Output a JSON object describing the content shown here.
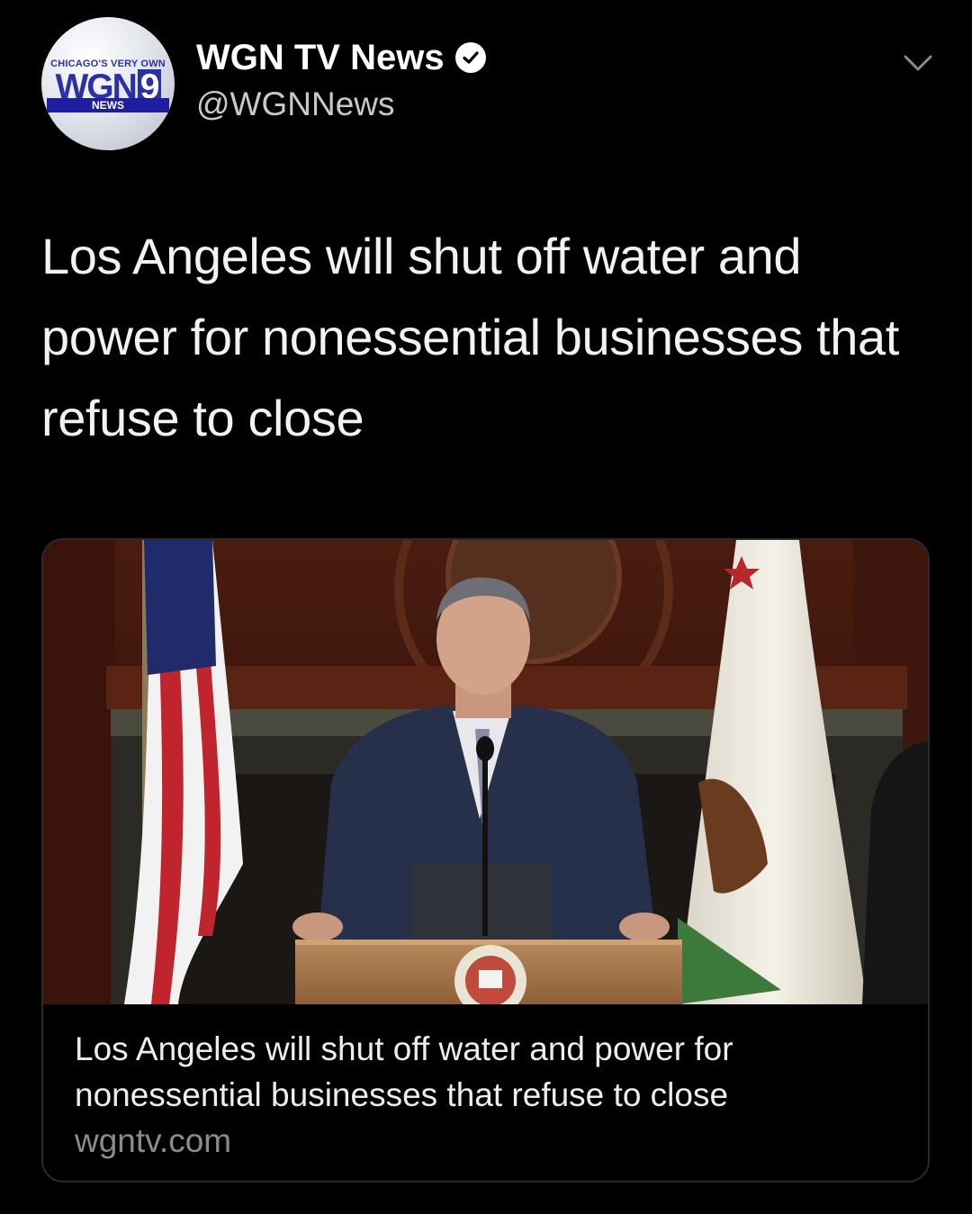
{
  "account": {
    "name": "WGN TV News",
    "handle": "@WGNNews",
    "avatar": {
      "tagline": "CHICAGO'S VERY OWN",
      "logo_text": "WGN",
      "logo_number": "9",
      "sub_label": "NEWS"
    }
  },
  "tweet": {
    "text": "Los Angeles will shut off water and power for nonessential businesses that refuse to close"
  },
  "link_card": {
    "title": "Los Angeles will shut off water and power for nonessential businesses that refuse to close",
    "domain": "wgntv.com"
  },
  "colors": {
    "background": "#000000",
    "text_primary": "#ffffff",
    "text_secondary": "#8b8b8b",
    "brand_blue": "#2b2fa8"
  },
  "icons": {
    "verified": "verified-badge-icon",
    "menu": "chevron-down-icon"
  }
}
